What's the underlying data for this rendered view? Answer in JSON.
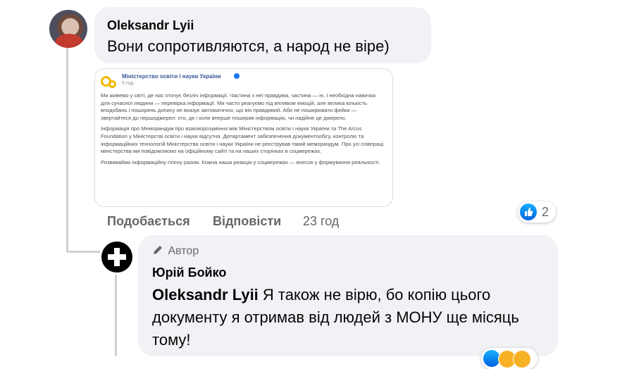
{
  "comment": {
    "author": "Oleksandr Lyii",
    "text": "Вони сопротивляются, а народ не віре)",
    "attachment": {
      "page_name": "Міністерство освіти і науки України",
      "time": "5 год · ",
      "paragraphs": [
        "Ми живемо у світі, де нас оточує безліч інформації. Частина з неї правдива, частина — ні. І необхідна навичка для сучасної людини — перевірка інформації. Ми часто реагуємо під впливом емоцій, але велика кількість вподобань і поширень допису не вказує автоматично, що він правдивий. Аби не поширювати фейки — звертайтеся до першоджерел: хто, де і коли вперше поширив інформацію, чи надійне це джерело.",
        "Інформація про Меморандум про взаєморозуміння між Міністерством освіти і науки України та The Arcus Foundation у Міністерстві освіти і науки відсутня. Департамент забезпечення документообігу, контролю та інформаційних технологій Міністерства освіти і науки України не реєстрував такий меморандум. Про усі співпраці міністерства ми повідомляємо на офіційному сайті та на наших сторінках в соцмережах.",
        "Розвиваймо інформаційну гігієну разом. Кожна наша реакція у соцмережах — внесок у формування реальності."
      ]
    },
    "actions": {
      "like": "Подобається",
      "reply": "Відповісти",
      "time": "23 год"
    },
    "reaction_count": "2",
    "reaction_icon": "like-icon"
  },
  "reply": {
    "badge": "Автор",
    "badge_icon": "pencil-icon",
    "author": "Юрій Бойко",
    "tag": "Oleksandr Lyii",
    "text": " Я також не вірю, бо копію цього документу я отримав від людей з МОНУ ще місяць тому!"
  },
  "colors": {
    "bubble": "#f0f2f5",
    "like_blue": "#1877f2",
    "muted": "#65676b",
    "thread_line": "#ccd0d5"
  }
}
